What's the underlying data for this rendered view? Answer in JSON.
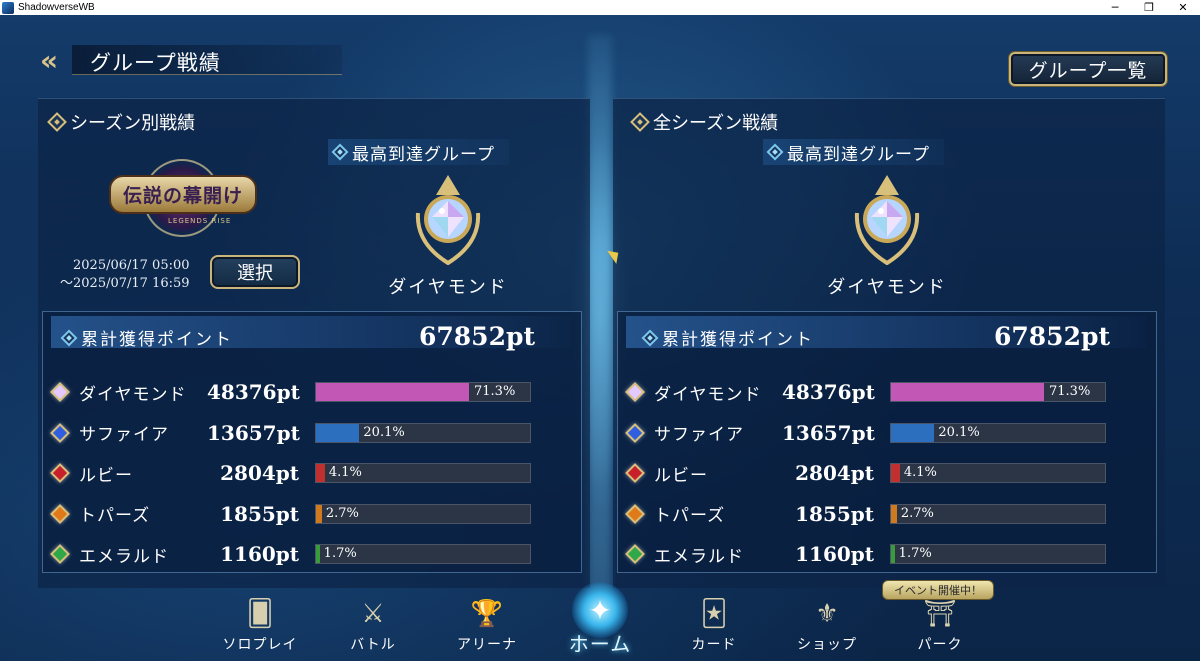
{
  "window": {
    "title": "ShadowverseWB",
    "minimize_icon": "minimize-icon",
    "restore_icon": "restore-icon",
    "close_icon": "close-icon",
    "minimize_glyph": "─",
    "restore_glyph": "❐",
    "close_glyph": "✕"
  },
  "header": {
    "back_glyph": "«",
    "title": "グループ戦績",
    "group_list_button": "グループ一覧"
  },
  "season_panel": {
    "heading": "シーズン別戦績",
    "season_logo_text": "伝説の幕開け",
    "season_logo_sub": "LEGENDS RISE",
    "date_start": "2025/06/17 05:00",
    "date_end": "〜2025/07/17 16:59",
    "select_button": "選択",
    "highest_group_label": "最高到達グループ",
    "highest_group_name": "ダイヤモンド",
    "points_label": "累計獲得ポイント",
    "points_total": "67852pt"
  },
  "all_panel": {
    "heading": "全シーズン戦績",
    "highest_group_label": "最高到達グループ",
    "highest_group_name": "ダイヤモンド",
    "points_label": "累計獲得ポイント",
    "points_total": "67852pt"
  },
  "ranks": [
    {
      "name": "ダイヤモンド",
      "points": "48376pt",
      "percent": "71.3%",
      "fraction": 0.713,
      "color": "#c357b5",
      "gem": "#e3c9ff"
    },
    {
      "name": "サファイア",
      "points": "13657pt",
      "percent": "20.1%",
      "fraction": 0.201,
      "color": "#2c6fbf",
      "gem": "#2f5fe0"
    },
    {
      "name": "ルビー",
      "points": "2804pt",
      "percent": "4.1%",
      "fraction": 0.041,
      "color": "#c0302f",
      "gem": "#c8202a"
    },
    {
      "name": "トパーズ",
      "points": "1855pt",
      "percent": "2.7%",
      "fraction": 0.027,
      "color": "#d07a20",
      "gem": "#e07a18"
    },
    {
      "name": "エメラルド",
      "points": "1160pt",
      "percent": "1.7%",
      "fraction": 0.017,
      "color": "#3a9b3a",
      "gem": "#2fa84a"
    }
  ],
  "nav": [
    {
      "label": "ソロプレイ",
      "icon": "solo-play-icon",
      "glyph": "🂠",
      "active": false
    },
    {
      "label": "バトル",
      "icon": "crossed-swords-icon",
      "glyph": "⚔",
      "active": false
    },
    {
      "label": "アリーナ",
      "icon": "trophy-icon",
      "glyph": "🏆",
      "active": false
    },
    {
      "label": "ホーム",
      "icon": "home-emblem-icon",
      "glyph": "✦",
      "active": true
    },
    {
      "label": "カード",
      "icon": "cards-icon",
      "glyph": "🃏",
      "active": false
    },
    {
      "label": "ショップ",
      "icon": "shop-icon",
      "glyph": "⚜",
      "active": false
    },
    {
      "label": "パーク",
      "icon": "park-icon",
      "glyph": "⛩",
      "active": false
    }
  ],
  "event_badge": "イベント開催中！",
  "colors": {
    "gold_border": "#c9b57a",
    "panel_bg": "#0c2446",
    "bar_track": "#2b3546"
  }
}
